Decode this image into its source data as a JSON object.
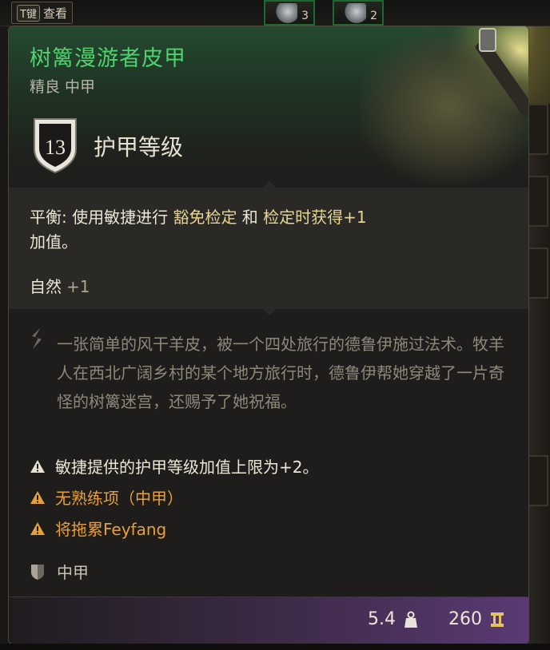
{
  "hotbar": {
    "key_tag": "T键",
    "view_label": "查看",
    "slots": [
      {
        "count": "3"
      },
      {
        "count": "2"
      }
    ]
  },
  "tooltip": {
    "title": "树篱漫游者皮甲",
    "subtitle": "精良 中甲",
    "armor_class_value": "13",
    "armor_class_label": "护甲等级",
    "effect": {
      "prefix": "平衡: 使用敏捷进行 ",
      "kw1": "豁免检定",
      "mid": " 和 ",
      "kw2": "检定时获得+1",
      "line2": "加值。"
    },
    "skill": {
      "name": "自然",
      "value": "+1"
    },
    "description": "一张简单的风干羊皮，被一个四处旅行的德鲁伊施过法术。牧羊人在西北广阔乡村的某个地方旅行时，德鲁伊帮她穿越了一片奇怪的树篱迷宫，还赐予了她祝福。",
    "warnings": [
      "敏捷提供的护甲等级加值上限为+2。",
      "无熟练项（中甲）",
      "将拖累Feyfang"
    ],
    "armor_type": "中甲",
    "weight": "5.4",
    "value": "260"
  },
  "colors": {
    "title": "#4fd26e",
    "warning": "#e5a03a",
    "keyword": "#e7d594",
    "description": "#8e877a"
  }
}
